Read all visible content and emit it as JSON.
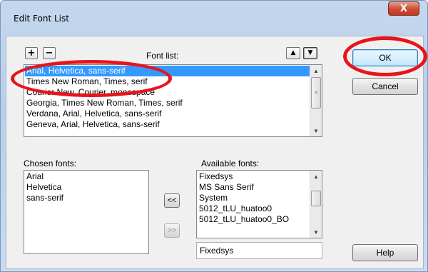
{
  "window": {
    "title": "Edit Font List",
    "close_glyph": "X"
  },
  "toolbar": {
    "add_glyph": "+",
    "remove_glyph": "−",
    "move_up_glyph": "▲",
    "move_down_glyph": "▼"
  },
  "font_list": {
    "label": "Font list:",
    "items": [
      "Arial, Helvetica, sans-serif",
      "Times New Roman, Times, serif",
      "Courier New, Courier, monospace",
      "Georgia, Times New Roman, Times, serif",
      "Verdana, Arial, Helvetica, sans-serif",
      "Geneva, Arial, Helvetica, sans-serif"
    ],
    "selected_index": 0
  },
  "chosen_fonts": {
    "label": "Chosen fonts:",
    "items": [
      "Arial",
      "Helvetica",
      "sans-serif"
    ]
  },
  "transfer": {
    "add_label": "<<",
    "remove_label": ">>"
  },
  "available_fonts": {
    "label": "Available fonts:",
    "items": [
      "Fixedsys",
      "MS Sans Serif",
      "System",
      "5012_tLU_huatoo0",
      "5012_tLU_huatoo0_BO"
    ],
    "field_value": "Fixedsys"
  },
  "buttons": {
    "ok": "OK",
    "cancel": "Cancel",
    "help": "Help"
  },
  "colors": {
    "highlight": "#e8141b",
    "selection": "#3399ff"
  }
}
